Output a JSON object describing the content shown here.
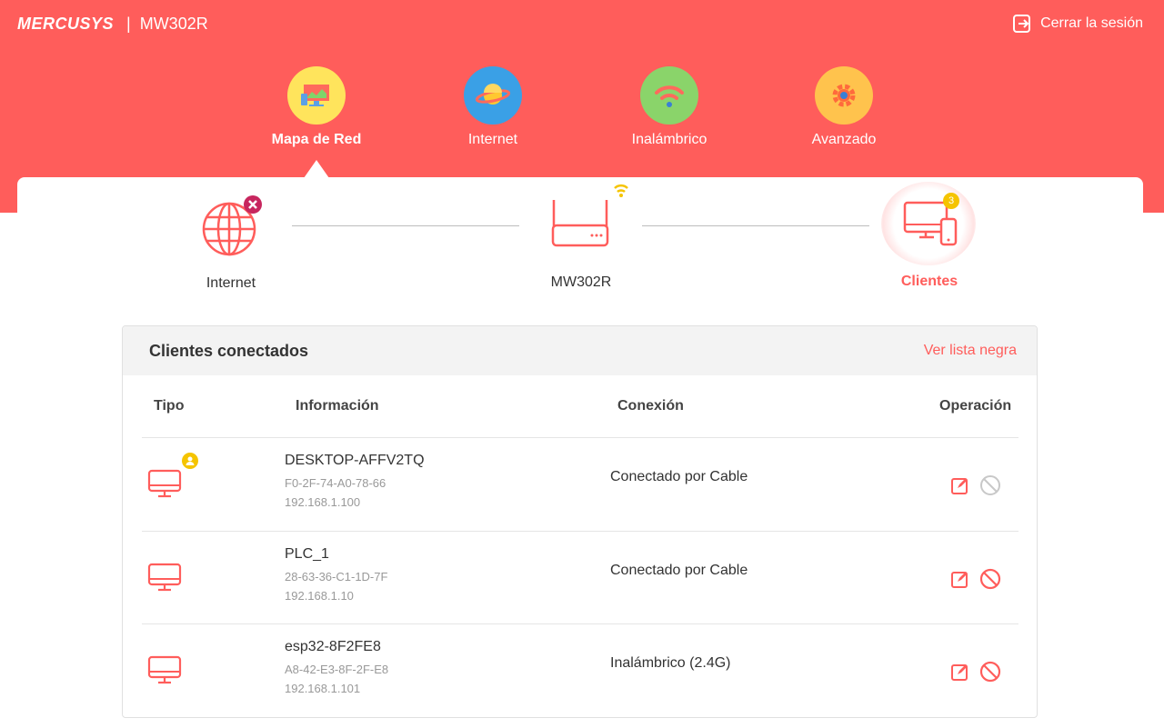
{
  "header": {
    "brand": "MERCUSYS",
    "model": "MW302R",
    "logout_label": "Cerrar la sesión"
  },
  "nav": {
    "items": [
      {
        "label": "Mapa de Red",
        "icon": "network-map-icon",
        "active": true
      },
      {
        "label": "Internet",
        "icon": "planet-icon",
        "active": false
      },
      {
        "label": "Inalámbrico",
        "icon": "wifi-icon",
        "active": false
      },
      {
        "label": "Avanzado",
        "icon": "gear-icon",
        "active": false
      }
    ]
  },
  "topology": {
    "internet_label": "Internet",
    "router_label": "MW302R",
    "clients_label": "Clientes",
    "clients_count": "3"
  },
  "panel": {
    "title": "Clientes conectados",
    "blacklist_link": "Ver lista negra",
    "columns": {
      "type": "Tipo",
      "info": "Información",
      "connection": "Conexión",
      "operation": "Operación"
    },
    "rows": [
      {
        "name": "DESKTOP-AFFV2TQ",
        "mac": "F0-2F-74-A0-78-66",
        "ip": "192.168.1.100",
        "connection": "Conectado por Cable",
        "is_host": true
      },
      {
        "name": "PLC_1",
        "mac": "28-63-36-C1-1D-7F",
        "ip": "192.168.1.10",
        "connection": "Conectado por Cable",
        "is_host": false
      },
      {
        "name": "esp32-8F2FE8",
        "mac": "A8-42-E3-8F-2F-E8",
        "ip": "192.168.1.101",
        "connection": "Inalámbrico (2.4G)",
        "is_host": false
      }
    ]
  },
  "colors": {
    "accent": "#ff5d5b",
    "badge": "#f5c400",
    "nav_map": "#ffe45c",
    "nav_internet": "#3aa0e6",
    "nav_wireless": "#8ad46a",
    "nav_advanced": "#ffc34d"
  }
}
